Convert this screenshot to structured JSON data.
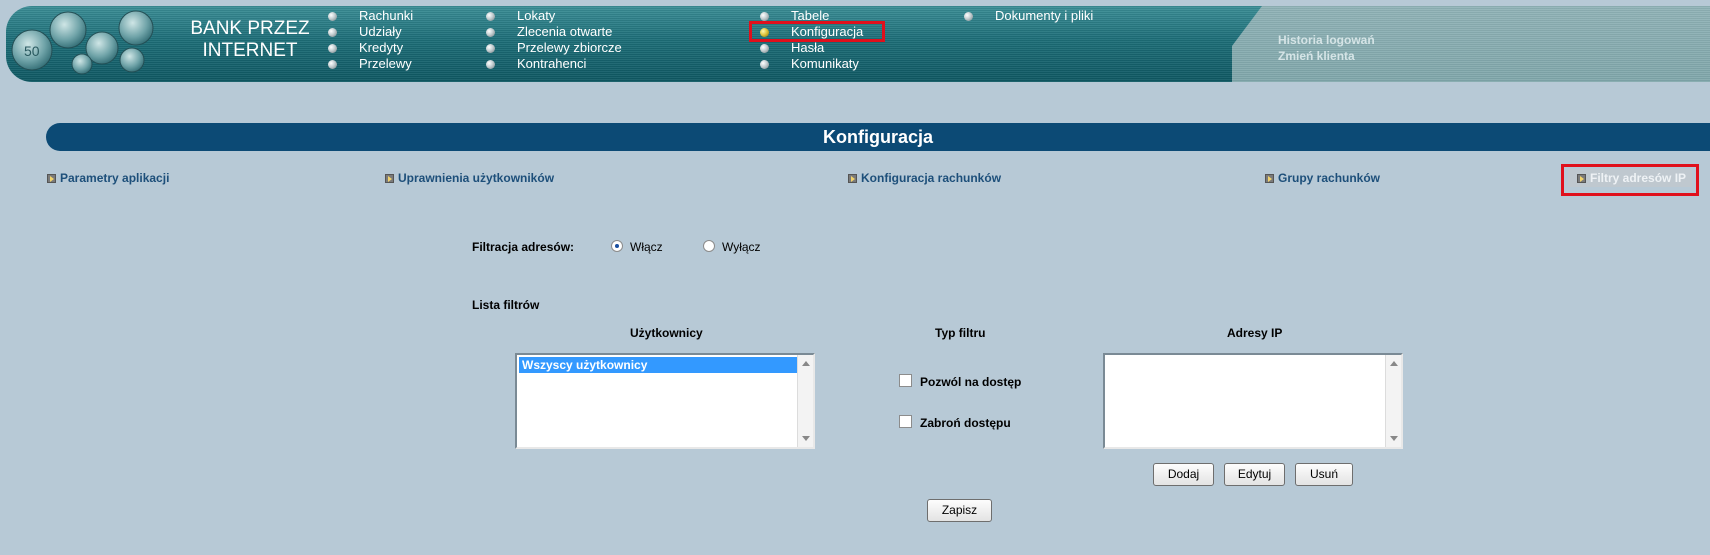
{
  "header": {
    "brand": [
      "BANK PRZEZ",
      "INTERNET"
    ],
    "nav_columns": [
      [
        "Rachunki",
        "Udziały",
        "Kredyty",
        "Przelewy"
      ],
      [
        "Lokaty",
        "Zlecenia otwarte",
        "Przelewy zbiorcze",
        "Kontrahenci"
      ],
      [
        "Tabele",
        "Konfiguracja",
        "Hasła",
        "Komunikaty"
      ],
      [
        "Dokumenty i pliki"
      ]
    ],
    "active_nav": "Konfiguracja",
    "right_links": [
      "Historia logowań",
      "Zmień klienta"
    ]
  },
  "page_title": "Konfiguracja",
  "subnav": {
    "items": [
      "Parametry aplikacji",
      "Uprawnienia użytkowników",
      "Konfiguracja rachunków",
      "Grupy rachunków",
      "Filtry adresów IP"
    ],
    "active": "Filtry adresów IP"
  },
  "filtering": {
    "label": "Filtracja adresów:",
    "options": [
      "Włącz",
      "Wyłącz"
    ],
    "selected": "Włącz"
  },
  "filter_list": {
    "label": "Lista filtrów",
    "users_header": "Użytkownicy",
    "type_header": "Typ filtru",
    "ip_header": "Adresy IP",
    "users": [
      "Wszyscy użytkownicy"
    ],
    "selected_user": "Wszyscy użytkownicy",
    "filter_types": [
      "Pozwól na dostęp",
      "Zabroń dostępu"
    ],
    "ip_addresses": []
  },
  "buttons": {
    "add": "Dodaj",
    "edit": "Edytuj",
    "delete": "Usuń",
    "save": "Zapisz"
  },
  "colors": {
    "page_bg": "#b7c9d6",
    "title_bar": "#0c4a75",
    "link": "#1d4f7a",
    "highlight": "#e0101c",
    "selection": "#3399ff"
  }
}
